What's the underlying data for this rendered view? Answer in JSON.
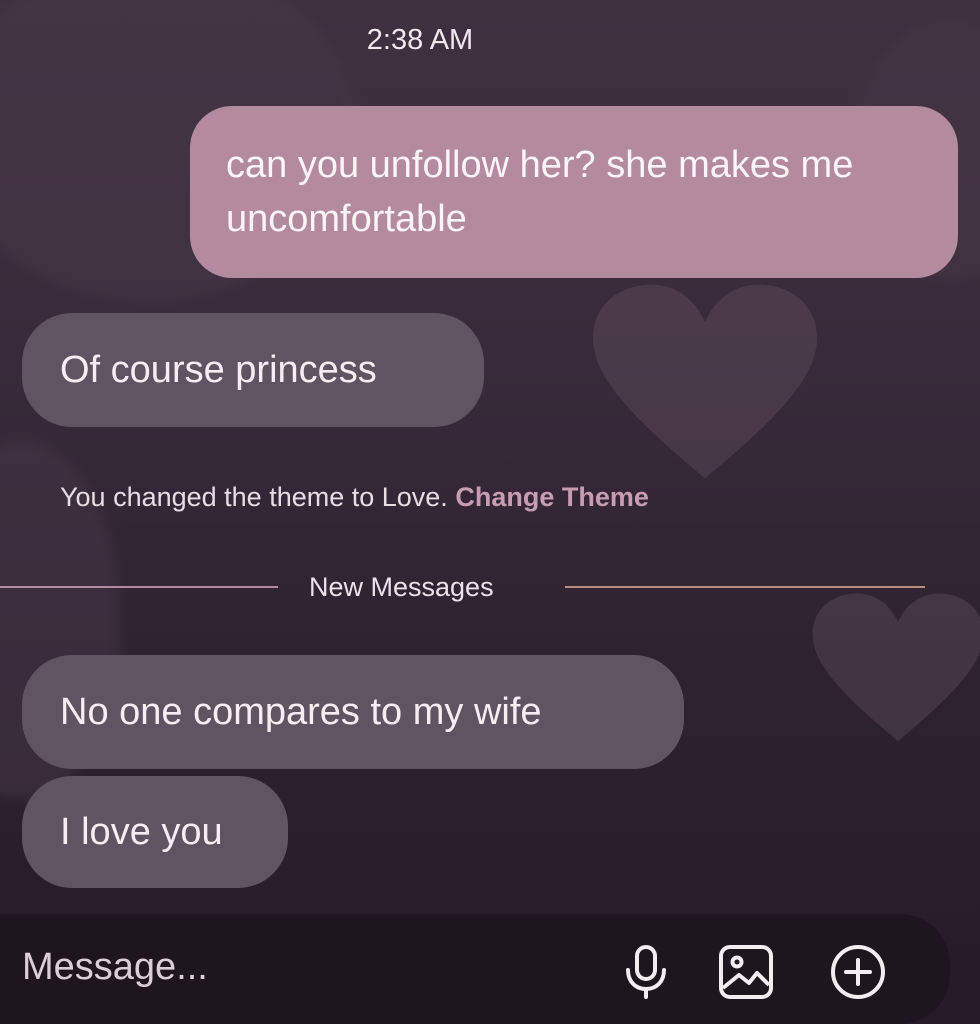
{
  "chat": {
    "timestamp": "2:38 AM",
    "messages": [
      {
        "from": "me",
        "text": "can you unfollow her? she makes me uncomfortable"
      },
      {
        "from": "them",
        "text": "Of course princess"
      },
      {
        "from": "them",
        "text": "No one compares to my wife"
      },
      {
        "from": "them",
        "text": "I love you"
      }
    ],
    "system": {
      "text": "You changed the theme to Love.",
      "link": "Change Theme"
    },
    "divider_label": "New Messages"
  },
  "composer": {
    "placeholder": "Message...",
    "icons": [
      "microphone-icon",
      "image-icon",
      "plus-circle-icon"
    ]
  },
  "theme": {
    "outgoing_bubble": "#b48a9f",
    "incoming_bubble": "#615462",
    "link_color": "#c99db1"
  }
}
